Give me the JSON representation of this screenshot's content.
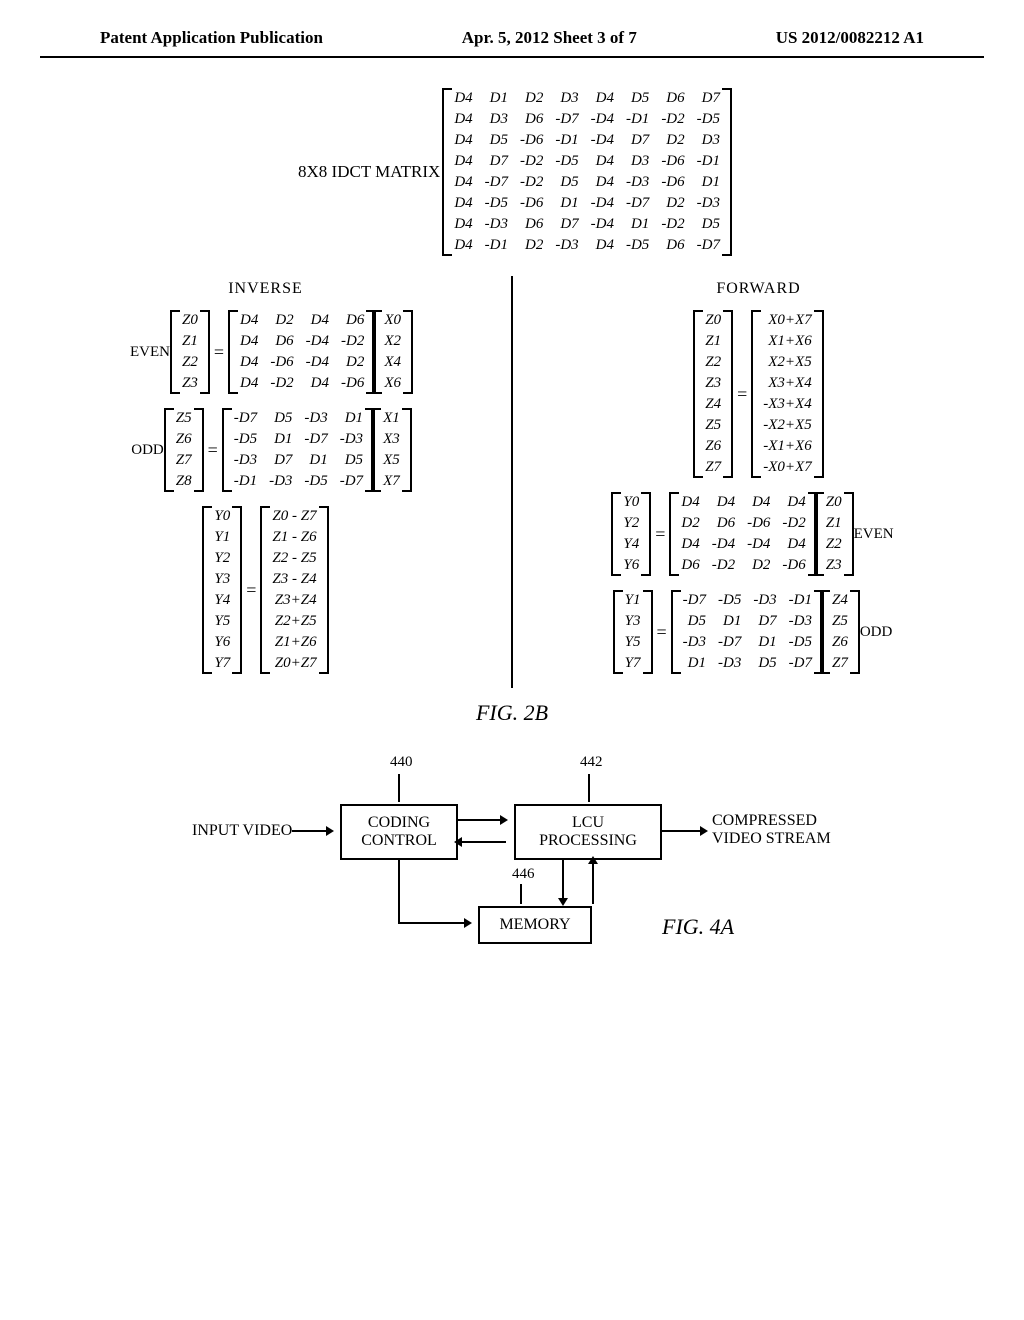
{
  "header": {
    "left": "Patent Application Publication",
    "mid": "Apr. 5, 2012  Sheet 3 of 7",
    "right": "US 2012/0082212 A1"
  },
  "top": {
    "label": "8X8 IDCT MATRIX",
    "rows": [
      [
        "D4",
        "D1",
        "D2",
        "D3",
        "D4",
        "D5",
        "D6",
        "D7"
      ],
      [
        "D4",
        "D3",
        "D6",
        "-D7",
        "-D4",
        "-D1",
        "-D2",
        "-D5"
      ],
      [
        "D4",
        "D5",
        "-D6",
        "-D1",
        "-D4",
        "D7",
        "D2",
        "D3"
      ],
      [
        "D4",
        "D7",
        "-D2",
        "-D5",
        "D4",
        "D3",
        "-D6",
        "-D1"
      ],
      [
        "D4",
        "-D7",
        "-D2",
        "D5",
        "D4",
        "-D3",
        "-D6",
        "D1"
      ],
      [
        "D4",
        "-D5",
        "-D6",
        "D1",
        "-D4",
        "-D7",
        "D2",
        "-D3"
      ],
      [
        "D4",
        "-D3",
        "D6",
        "D7",
        "-D4",
        "D1",
        "-D2",
        "D5"
      ],
      [
        "D4",
        "-D1",
        "D2",
        "-D3",
        "D4",
        "-D5",
        "D6",
        "-D7"
      ]
    ]
  },
  "inverse": {
    "title": "INVERSE",
    "even_label": "EVEN",
    "odd_label": "ODD",
    "even_lhs": [
      "Z0",
      "Z1",
      "Z2",
      "Z3"
    ],
    "even_mat": [
      [
        "D4",
        "D2",
        "D4",
        "D6"
      ],
      [
        "D4",
        "D6",
        "-D4",
        "-D2"
      ],
      [
        "D4",
        "-D6",
        "-D4",
        "D2"
      ],
      [
        "D4",
        "-D2",
        "D4",
        "-D6"
      ]
    ],
    "even_rhs": [
      "X0",
      "X2",
      "X4",
      "X6"
    ],
    "odd_lhs": [
      "Z5",
      "Z6",
      "Z7",
      "Z8"
    ],
    "odd_mat": [
      [
        "-D7",
        "D5",
        "-D3",
        "D1"
      ],
      [
        "-D5",
        "D1",
        "-D7",
        "-D3"
      ],
      [
        "-D3",
        "D7",
        "D1",
        "D5"
      ],
      [
        "-D1",
        "-D3",
        "-D5",
        "-D7"
      ]
    ],
    "odd_rhs": [
      "X1",
      "X3",
      "X5",
      "X7"
    ],
    "y_lhs": [
      "Y0",
      "Y1",
      "Y2",
      "Y3",
      "Y4",
      "Y5",
      "Y6",
      "Y7"
    ],
    "y_rhs": [
      "Z0 - Z7",
      "Z1 - Z6",
      "Z2 - Z5",
      "Z3 - Z4",
      "Z3+Z4",
      "Z2+Z5",
      "Z1+Z6",
      "Z0+Z7"
    ]
  },
  "forward": {
    "title": "FORWARD",
    "z_lhs": [
      "Z0",
      "Z1",
      "Z2",
      "Z3",
      "Z4",
      "Z5",
      "Z6",
      "Z7"
    ],
    "z_rhs": [
      "X0+X7",
      "X1+X6",
      "X2+X5",
      "X3+X4",
      "-X3+X4",
      "-X2+X5",
      "-X1+X6",
      "-X0+X7"
    ],
    "even_label": "EVEN",
    "odd_label": "ODD",
    "even_lhs": [
      "Y0",
      "Y2",
      "Y4",
      "Y6"
    ],
    "even_mat": [
      [
        "D4",
        "D4",
        "D4",
        "D4"
      ],
      [
        "D2",
        "D6",
        "-D6",
        "-D2"
      ],
      [
        "D4",
        "-D4",
        "-D4",
        "D4"
      ],
      [
        "D6",
        "-D2",
        "D2",
        "-D6"
      ]
    ],
    "even_rhs": [
      "Z0",
      "Z1",
      "Z2",
      "Z3"
    ],
    "odd_lhs": [
      "Y1",
      "Y3",
      "Y5",
      "Y7"
    ],
    "odd_mat": [
      [
        "-D7",
        "-D5",
        "-D3",
        "-D1"
      ],
      [
        "D5",
        "D1",
        "D7",
        "-D3"
      ],
      [
        "-D3",
        "-D7",
        "D1",
        "-D5"
      ],
      [
        "D1",
        "-D3",
        "D5",
        "-D7"
      ]
    ],
    "odd_rhs": [
      "Z4",
      "Z5",
      "Z6",
      "Z7"
    ]
  },
  "fig2b": "FIG. 2B",
  "diagram": {
    "input": "INPUT VIDEO",
    "box1_l1": "CODING",
    "box1_l2": "CONTROL",
    "box2_l1": "LCU",
    "box2_l2": "PROCESSING",
    "box3": "MEMORY",
    "out_l1": "COMPRESSED",
    "out_l2": "VIDEO STREAM",
    "ref1": "440",
    "ref2": "442",
    "ref3": "446",
    "figlabel": "FIG. 4A"
  }
}
